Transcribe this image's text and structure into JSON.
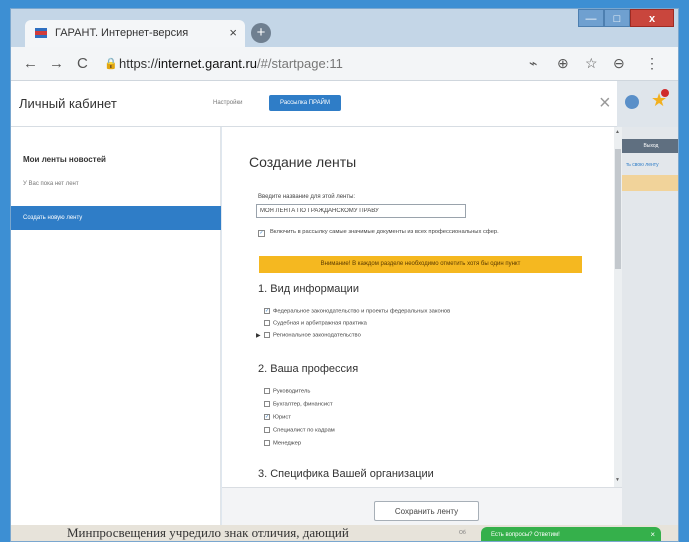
{
  "browser": {
    "tab_title": "ГАРАНТ. Интернет-версия",
    "tab_close": "×",
    "new_tab": "+",
    "url_scheme": "https://",
    "url_host": "internet.garant.ru",
    "url_path": "/#/startpage:11",
    "nav_back": "←",
    "nav_forward": "→",
    "nav_reload": "C",
    "lock_glyph": "🔒",
    "tools": [
      "⌁",
      "⊕",
      "☆",
      "⊖",
      "⋮"
    ]
  },
  "window_controls": {
    "minimize": "—",
    "maximize": "□",
    "close": "x"
  },
  "header": {
    "title": "Личный кабинет",
    "settings_label": "Настройки",
    "mailing_label": "Рассылка ПРАЙМ",
    "close": "×"
  },
  "sidebar": {
    "title": "Мои ленты новостей",
    "empty_text": "У Вас пока нет лент",
    "create_label": "Создать новую ленту"
  },
  "form": {
    "title": "Создание ленты",
    "name_label": "Введите название для этой ленты:",
    "name_value": "МОЯ ЛЕНТА ПО ГРАЖДАНСКОМУ ПРАВУ",
    "include_important_label": "Включить в рассылку самые значимые документы из всех профессиональных сфер.",
    "include_important_checked": true,
    "warning": "Внимание! В каждом разделе необходимо отметить хотя бы один пункт",
    "sections": [
      {
        "title": "1. Вид информации",
        "options": [
          {
            "label": "Федеральное законодательство и проекты федеральных законов",
            "checked": true
          },
          {
            "label": "Судебная и арбитражная практика",
            "checked": false
          },
          {
            "label": "Региональное законодательство",
            "checked": false,
            "expandable": true
          }
        ]
      },
      {
        "title": "2. Ваша профессия",
        "options": [
          {
            "label": "Руководитель",
            "checked": false
          },
          {
            "label": "Бухгалтер, финансист",
            "checked": false
          },
          {
            "label": "Юрист",
            "checked": true
          },
          {
            "label": "Специалист по кадрам",
            "checked": false
          },
          {
            "label": "Менеджер",
            "checked": false
          }
        ]
      },
      {
        "title": "3. Специфика Вашей организации",
        "options": []
      }
    ],
    "save_label": "Сохранить ленту"
  },
  "right_panel": {
    "button_label": "Выход",
    "link_label": "ть свою ленту"
  },
  "page_bottom": {
    "text": "Минпросвещения учредило знак отличия, дающий",
    "mini_label": "Об",
    "chat_label": "Есть вопросы? Ответим!",
    "chat_close": "×"
  },
  "colors": {
    "accent": "#2f7dc7",
    "warning": "#f5b820",
    "chat": "#35b04b",
    "background": "#3d8fd3"
  }
}
